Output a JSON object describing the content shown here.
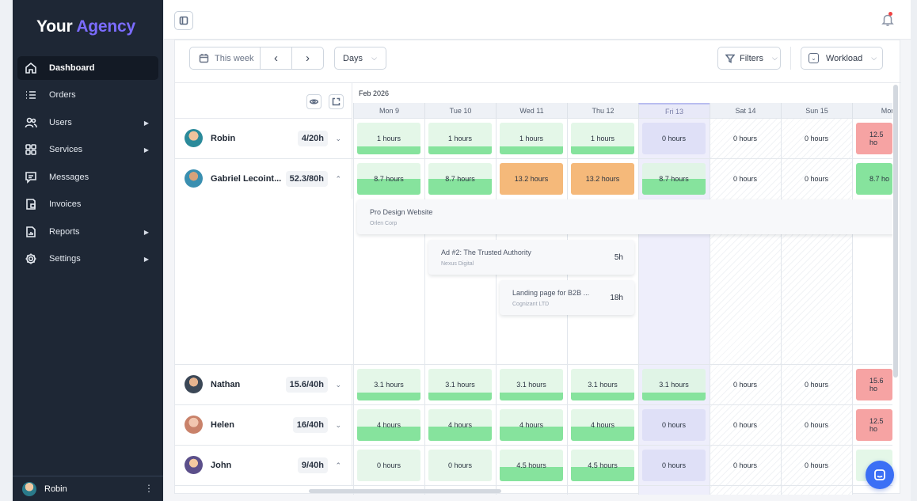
{
  "logo": {
    "part1": "Your",
    "part2": "Agency"
  },
  "sidebar": {
    "items": [
      {
        "label": "Dashboard",
        "icon": "home-icon",
        "active": true
      },
      {
        "label": "Orders",
        "icon": "list-icon"
      },
      {
        "label": "Users",
        "icon": "users-icon",
        "caret": "▶"
      },
      {
        "label": "Services",
        "icon": "grid-icon",
        "caret": "▶"
      },
      {
        "label": "Messages",
        "icon": "message-icon"
      },
      {
        "label": "Invoices",
        "icon": "invoice-icon"
      },
      {
        "label": "Reports",
        "icon": "report-icon",
        "caret": "▶"
      },
      {
        "label": "Settings",
        "icon": "gear-icon",
        "caret": "▶"
      }
    ],
    "footer_user": "Robin",
    "footer_menu": "⋮"
  },
  "toolbar": {
    "week_label": "This week",
    "prev": "‹",
    "next": "›",
    "view": "Days",
    "filters": "Filters",
    "workload": "Workload",
    "chevron": "⌵"
  },
  "calendar": {
    "month": "Feb 2026",
    "days": [
      "Mon 9",
      "Tue 10",
      "Wed 11",
      "Thu 12",
      "Fri 13",
      "Sat 14",
      "Sun 15",
      "Mon"
    ]
  },
  "people": [
    {
      "name": "Robin",
      "hours": "4/20h",
      "chev": "⌄",
      "cells": [
        "1 hours",
        "1 hours",
        "1 hours",
        "1 hours",
        "0 hours",
        "0 hours",
        "0 hours",
        "12.5 ho"
      ]
    },
    {
      "name": "Gabriel Lecoint...",
      "hours": "52.3/80h",
      "chev": "⌃",
      "cells": [
        "8.7 hours",
        "8.7 hours",
        "13.2 hours",
        "13.2 hours",
        "8.7 hours",
        "0 hours",
        "0 hours",
        "8.7 ho"
      ]
    },
    {
      "name": "Nathan",
      "hours": "15.6/40h",
      "chev": "⌄",
      "cells": [
        "3.1 hours",
        "3.1 hours",
        "3.1 hours",
        "3.1 hours",
        "3.1 hours",
        "0 hours",
        "0 hours",
        "15.6 ho"
      ]
    },
    {
      "name": "Helen",
      "hours": "16/40h",
      "chev": "⌄",
      "cells": [
        "4 hours",
        "4 hours",
        "4 hours",
        "4 hours",
        "0 hours",
        "0 hours",
        "0 hours",
        "12.5 ho"
      ]
    },
    {
      "name": "John",
      "hours": "9/40h",
      "chev": "⌃",
      "cells": [
        "0 hours",
        "0 hours",
        "4.5 hours",
        "4.5 hours",
        "0 hours",
        "0 hours",
        "0 hours",
        ""
      ]
    }
  ],
  "tasks": [
    {
      "title": "Pro Design Website",
      "client": "Orlen Corp",
      "hours": ""
    },
    {
      "title": "Ad #2: The Trusted Authority",
      "client": "Nexus Digital",
      "hours": "5h"
    },
    {
      "title": "Landing page for B2B ...",
      "client": "Cognizant LTD",
      "hours": "18h"
    }
  ],
  "colors": {
    "accent": "#7b6cff",
    "sidebar": "#1e2735",
    "green": "#86e39d",
    "orange": "#f5b97a",
    "red": "#f6a3a3",
    "chat": "#3b6ff5"
  }
}
